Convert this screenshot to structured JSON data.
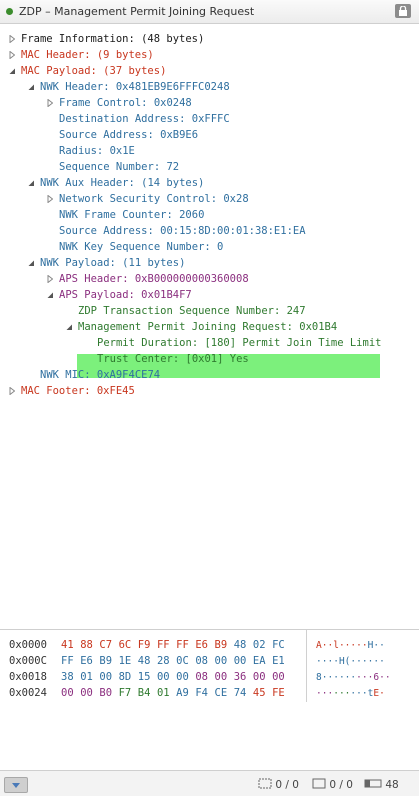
{
  "window": {
    "title": "ZDP – Management Permit Joining Request"
  },
  "tree": [
    {
      "text": "Frame Information: (48 bytes)",
      "color": "black",
      "toggle": "collapsed"
    },
    {
      "text": "MAC Header: (9 bytes)",
      "color": "red",
      "toggle": "collapsed"
    },
    {
      "text": "MAC Payload: (37 bytes)",
      "color": "red",
      "toggle": "expanded"
    },
    {
      "text": "NWK Header: 0x481EB9E6FFFC0248",
      "color": "blue",
      "toggle": "expanded"
    },
    {
      "text": "Frame Control: 0x0248",
      "color": "blue",
      "toggle": "collapsed"
    },
    {
      "text": "Destination Address: 0xFFFC",
      "color": "blue",
      "toggle": "none"
    },
    {
      "text": "Source Address: 0xB9E6",
      "color": "blue",
      "toggle": "none"
    },
    {
      "text": "Radius: 0x1E",
      "color": "blue",
      "toggle": "none"
    },
    {
      "text": "Sequence Number: 72",
      "color": "blue",
      "toggle": "none"
    },
    {
      "text": "NWK Aux Header: (14 bytes)",
      "color": "blue",
      "toggle": "expanded"
    },
    {
      "text": "Network Security Control: 0x28",
      "color": "blue",
      "toggle": "collapsed"
    },
    {
      "text": "NWK Frame Counter: 2060",
      "color": "blue",
      "toggle": "none"
    },
    {
      "text": "Source Address: 00:15:8D:00:01:38:E1:EA",
      "color": "blue",
      "toggle": "none"
    },
    {
      "text": "NWK Key Sequence Number: 0",
      "color": "blue",
      "toggle": "none"
    },
    {
      "text": "NWK Payload: (11 bytes)",
      "color": "blue",
      "toggle": "expanded"
    },
    {
      "text": "APS Header: 0xB000000000360008",
      "color": "purple",
      "toggle": "collapsed"
    },
    {
      "text": "APS Payload: 0x01B4F7",
      "color": "purple",
      "toggle": "expanded"
    },
    {
      "text": "ZDP Transaction Sequence Number: 247",
      "color": "green",
      "toggle": "none"
    },
    {
      "text": "Management Permit Joining Request: 0x01B4",
      "color": "green",
      "toggle": "expanded"
    },
    {
      "text": "Permit Duration: [180] Permit Join Time Limit",
      "color": "green",
      "toggle": "none"
    },
    {
      "text": "Trust Center: [0x01] Yes",
      "color": "green",
      "toggle": "none"
    },
    {
      "text": "NWK MIC: 0xA9F4CE74",
      "color": "blue",
      "toggle": "none"
    },
    {
      "text": "MAC Footer: 0xFE45",
      "color": "red",
      "toggle": "collapsed"
    }
  ],
  "hex": [
    {
      "offset": "0x0000",
      "bytes": [
        [
          "41",
          "red"
        ],
        [
          "88",
          "red"
        ],
        [
          "C7",
          "red"
        ],
        [
          "6C",
          "red"
        ],
        [
          "F9",
          "red"
        ],
        [
          "FF",
          "red"
        ],
        [
          "FF",
          "red"
        ],
        [
          "E6",
          "red"
        ],
        [
          "B9",
          "red"
        ],
        [
          "48",
          "blue"
        ],
        [
          "02",
          "blue"
        ],
        [
          "FC",
          "blue"
        ]
      ],
      "ascii": "A··l·····H··"
    },
    {
      "offset": "0x000C",
      "bytes": [
        [
          "FF",
          "blue"
        ],
        [
          "E6",
          "blue"
        ],
        [
          "B9",
          "blue"
        ],
        [
          "1E",
          "blue"
        ],
        [
          "48",
          "blue"
        ],
        [
          "28",
          "blue"
        ],
        [
          "0C",
          "blue"
        ],
        [
          "08",
          "blue"
        ],
        [
          "00",
          "blue"
        ],
        [
          "00",
          "blue"
        ],
        [
          "EA",
          "blue"
        ],
        [
          "E1",
          "blue"
        ]
      ],
      "ascii": "····H(······"
    },
    {
      "offset": "0x0018",
      "bytes": [
        [
          "38",
          "blue"
        ],
        [
          "01",
          "blue"
        ],
        [
          "00",
          "blue"
        ],
        [
          "8D",
          "blue"
        ],
        [
          "15",
          "blue"
        ],
        [
          "00",
          "blue"
        ],
        [
          "00",
          "blue"
        ],
        [
          "08",
          "purple"
        ],
        [
          "00",
          "purple"
        ],
        [
          "36",
          "purple"
        ],
        [
          "00",
          "purple"
        ],
        [
          "00",
          "purple"
        ]
      ],
      "ascii": "8·········6··"
    },
    {
      "offset": "0x0024",
      "bytes": [
        [
          "00",
          "purple"
        ],
        [
          "00",
          "purple"
        ],
        [
          "B0",
          "purple"
        ],
        [
          "F7",
          "green"
        ],
        [
          "B4",
          "green"
        ],
        [
          "01",
          "green"
        ],
        [
          "A9",
          "blue"
        ],
        [
          "F4",
          "blue"
        ],
        [
          "CE",
          "blue"
        ],
        [
          "74",
          "blue"
        ],
        [
          "45",
          "red"
        ],
        [
          "FE",
          "red"
        ]
      ],
      "ascii": "·········tE·"
    }
  ],
  "status": {
    "selection": "0 / 0",
    "marks": "0 / 0",
    "length": "48"
  },
  "colors": {
    "red": "#c8361e",
    "blue": "#2f6f9f",
    "purple": "#8b2f7f",
    "green": "#2f7a2f",
    "highlight": "#7cf07c"
  }
}
